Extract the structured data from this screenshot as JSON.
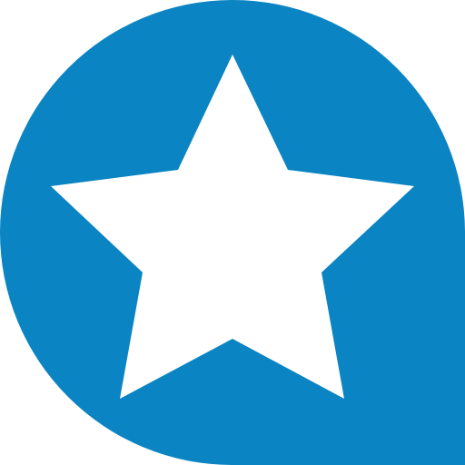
{
  "icon": {
    "name": "star-speech-bubble-icon",
    "shape": "teardrop",
    "glyph": "star",
    "colors": {
      "background": "#0A84C2",
      "glyph": "#FFFFFF"
    }
  }
}
